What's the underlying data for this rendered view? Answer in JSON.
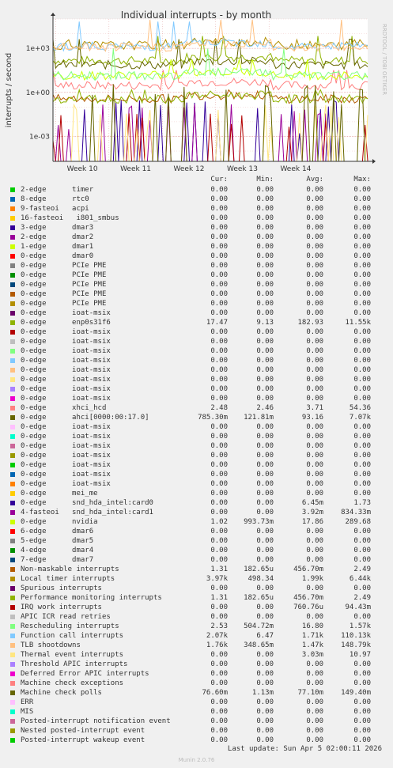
{
  "chart_data": {
    "type": "line",
    "title": "Individual interrupts - by month",
    "ylabel": "interrupts / second",
    "watermark": "RRDTOOL / TOBI OETIKER",
    "yscale": "log",
    "ylim": [
      2e-05,
      100000
    ],
    "yticks": [
      "1e+03",
      "1e+00",
      "1e-03"
    ],
    "xticks": [
      "Week 10",
      "Week 11",
      "Week 12",
      "Week 13",
      "Week 14"
    ],
    "grid": true,
    "series_note": "values read off the legend table; lines drawn as approximate levels"
  },
  "legend": {
    "headers": {
      "cur": "Cur:",
      "min": "Min:",
      "avg": "Avg:",
      "max": "Max:"
    },
    "rows": [
      {
        "color": "#00cc00",
        "label": "2-edge      timer",
        "cur": "0.00",
        "min": "0.00",
        "avg": "0.00",
        "max": "0.00"
      },
      {
        "color": "#0066b3",
        "label": "8-edge      rtc0",
        "cur": "0.00",
        "min": "0.00",
        "avg": "0.00",
        "max": "0.00"
      },
      {
        "color": "#ff8000",
        "label": "9-fasteoi   acpi",
        "cur": "0.00",
        "min": "0.00",
        "avg": "0.00",
        "max": "0.00"
      },
      {
        "color": "#ffcc00",
        "label": "16-fasteoi   i801_smbus",
        "cur": "0.00",
        "min": "0.00",
        "avg": "0.00",
        "max": "0.00"
      },
      {
        "color": "#330099",
        "label": "3-edge      dmar3",
        "cur": "0.00",
        "min": "0.00",
        "avg": "0.00",
        "max": "0.00"
      },
      {
        "color": "#990099",
        "label": "2-edge      dmar2",
        "cur": "0.00",
        "min": "0.00",
        "avg": "0.00",
        "max": "0.00"
      },
      {
        "color": "#ccff00",
        "label": "1-edge      dmar1",
        "cur": "0.00",
        "min": "0.00",
        "avg": "0.00",
        "max": "0.00"
      },
      {
        "color": "#ff0000",
        "label": "0-edge      dmar0",
        "cur": "0.00",
        "min": "0.00",
        "avg": "0.00",
        "max": "0.00"
      },
      {
        "color": "#808080",
        "label": "0-edge      PCIe PME",
        "cur": "0.00",
        "min": "0.00",
        "avg": "0.00",
        "max": "0.00"
      },
      {
        "color": "#008f00",
        "label": "0-edge      PCIe PME",
        "cur": "0.00",
        "min": "0.00",
        "avg": "0.00",
        "max": "0.00"
      },
      {
        "color": "#00487d",
        "label": "0-edge      PCIe PME",
        "cur": "0.00",
        "min": "0.00",
        "avg": "0.00",
        "max": "0.00"
      },
      {
        "color": "#b35a00",
        "label": "0-edge      PCIe PME",
        "cur": "0.00",
        "min": "0.00",
        "avg": "0.00",
        "max": "0.00"
      },
      {
        "color": "#b38f00",
        "label": "0-edge      PCIe PME",
        "cur": "0.00",
        "min": "0.00",
        "avg": "0.00",
        "max": "0.00"
      },
      {
        "color": "#6b006b",
        "label": "0-edge      ioat-msix",
        "cur": "0.00",
        "min": "0.00",
        "avg": "0.00",
        "max": "0.00"
      },
      {
        "color": "#8fb300",
        "label": "0-edge      enp0s31f6",
        "cur": "17.47",
        "min": "9.13",
        "avg": "182.93",
        "max": "11.55k"
      },
      {
        "color": "#b30000",
        "label": "0-edge      ioat-msix",
        "cur": "0.00",
        "min": "0.00",
        "avg": "0.00",
        "max": "0.00"
      },
      {
        "color": "#bebebe",
        "label": "0-edge      ioat-msix",
        "cur": "0.00",
        "min": "0.00",
        "avg": "0.00",
        "max": "0.00"
      },
      {
        "color": "#80ff80",
        "label": "0-edge      ioat-msix",
        "cur": "0.00",
        "min": "0.00",
        "avg": "0.00",
        "max": "0.00"
      },
      {
        "color": "#80c9ff",
        "label": "0-edge      ioat-msix",
        "cur": "0.00",
        "min": "0.00",
        "avg": "0.00",
        "max": "0.00"
      },
      {
        "color": "#ffc080",
        "label": "0-edge      ioat-msix",
        "cur": "0.00",
        "min": "0.00",
        "avg": "0.00",
        "max": "0.00"
      },
      {
        "color": "#ffe680",
        "label": "0-edge      ioat-msix",
        "cur": "0.00",
        "min": "0.00",
        "avg": "0.00",
        "max": "0.00"
      },
      {
        "color": "#aa80ff",
        "label": "0-edge      ioat-msix",
        "cur": "0.00",
        "min": "0.00",
        "avg": "0.00",
        "max": "0.00"
      },
      {
        "color": "#ee00cc",
        "label": "0-edge      ioat-msix",
        "cur": "0.00",
        "min": "0.00",
        "avg": "0.00",
        "max": "0.00"
      },
      {
        "color": "#ff8080",
        "label": "0-edge      xhci_hcd",
        "cur": "2.48",
        "min": "2.46",
        "avg": "3.71",
        "max": "54.36"
      },
      {
        "color": "#666600",
        "label": "0-edge      ahci[0000:00:17.0]",
        "cur": "785.30m",
        "min": "121.81m",
        "avg": "93.16",
        "max": "7.07k"
      },
      {
        "color": "#ffbfff",
        "label": "0-edge      ioat-msix",
        "cur": "0.00",
        "min": "0.00",
        "avg": "0.00",
        "max": "0.00"
      },
      {
        "color": "#00ffcc",
        "label": "0-edge      ioat-msix",
        "cur": "0.00",
        "min": "0.00",
        "avg": "0.00",
        "max": "0.00"
      },
      {
        "color": "#cc6699",
        "label": "0-edge      ioat-msix",
        "cur": "0.00",
        "min": "0.00",
        "avg": "0.00",
        "max": "0.00"
      },
      {
        "color": "#999900",
        "label": "0-edge      ioat-msix",
        "cur": "0.00",
        "min": "0.00",
        "avg": "0.00",
        "max": "0.00"
      },
      {
        "color": "#00cc00",
        "label": "0-edge      ioat-msix",
        "cur": "0.00",
        "min": "0.00",
        "avg": "0.00",
        "max": "0.00"
      },
      {
        "color": "#0066b3",
        "label": "0-edge      ioat-msix",
        "cur": "0.00",
        "min": "0.00",
        "avg": "0.00",
        "max": "0.00"
      },
      {
        "color": "#ff8000",
        "label": "0-edge      ioat-msix",
        "cur": "0.00",
        "min": "0.00",
        "avg": "0.00",
        "max": "0.00"
      },
      {
        "color": "#ffcc00",
        "label": "0-edge      mei_me",
        "cur": "0.00",
        "min": "0.00",
        "avg": "0.00",
        "max": "0.00"
      },
      {
        "color": "#330099",
        "label": "0-edge      snd_hda_intel:card0",
        "cur": "0.00",
        "min": "0.00",
        "avg": "6.45m",
        "max": "1.73"
      },
      {
        "color": "#990099",
        "label": "4-fasteoi   snd_hda_intel:card1",
        "cur": "0.00",
        "min": "0.00",
        "avg": "3.92m",
        "max": "834.33m"
      },
      {
        "color": "#ccff00",
        "label": "0-edge      nvidia",
        "cur": "1.02",
        "min": "993.73m",
        "avg": "17.86",
        "max": "289.68"
      },
      {
        "color": "#ff0000",
        "label": "6-edge      dmar6",
        "cur": "0.00",
        "min": "0.00",
        "avg": "0.00",
        "max": "0.00"
      },
      {
        "color": "#808080",
        "label": "5-edge      dmar5",
        "cur": "0.00",
        "min": "0.00",
        "avg": "0.00",
        "max": "0.00"
      },
      {
        "color": "#008f00",
        "label": "4-edge      dmar4",
        "cur": "0.00",
        "min": "0.00",
        "avg": "0.00",
        "max": "0.00"
      },
      {
        "color": "#00487d",
        "label": "7-edge      dmar7",
        "cur": "0.00",
        "min": "0.00",
        "avg": "0.00",
        "max": "0.00"
      },
      {
        "color": "#b35a00",
        "label": "Non-maskable interrupts",
        "cur": "1.31",
        "min": "182.65u",
        "avg": "456.70m",
        "max": "2.49"
      },
      {
        "color": "#b38f00",
        "label": "Local timer interrupts",
        "cur": "3.97k",
        "min": "498.34",
        "avg": "1.99k",
        "max": "6.44k"
      },
      {
        "color": "#6b006b",
        "label": "Spurious interrupts",
        "cur": "0.00",
        "min": "0.00",
        "avg": "0.00",
        "max": "0.00"
      },
      {
        "color": "#8fb300",
        "label": "Performance monitoring interrupts",
        "cur": "1.31",
        "min": "182.65u",
        "avg": "456.70m",
        "max": "2.49"
      },
      {
        "color": "#b30000",
        "label": "IRQ work interrupts",
        "cur": "0.00",
        "min": "0.00",
        "avg": "760.76u",
        "max": "94.43m"
      },
      {
        "color": "#bebebe",
        "label": "APIC ICR read retries",
        "cur": "0.00",
        "min": "0.00",
        "avg": "0.00",
        "max": "0.00"
      },
      {
        "color": "#80ff80",
        "label": "Rescheduling interrupts",
        "cur": "2.53",
        "min": "504.72m",
        "avg": "16.80",
        "max": "1.57k"
      },
      {
        "color": "#80c9ff",
        "label": "Function call interrupts",
        "cur": "2.07k",
        "min": "6.47",
        "avg": "1.71k",
        "max": "110.13k"
      },
      {
        "color": "#ffc080",
        "label": "TLB shootdowns",
        "cur": "1.76k",
        "min": "348.65m",
        "avg": "1.47k",
        "max": "148.79k"
      },
      {
        "color": "#ffe680",
        "label": "Thermal event interrupts",
        "cur": "0.00",
        "min": "0.00",
        "avg": "3.03m",
        "max": "10.97"
      },
      {
        "color": "#aa80ff",
        "label": "Threshold APIC interrupts",
        "cur": "0.00",
        "min": "0.00",
        "avg": "0.00",
        "max": "0.00"
      },
      {
        "color": "#ee00cc",
        "label": "Deferred Error APIC interrupts",
        "cur": "0.00",
        "min": "0.00",
        "avg": "0.00",
        "max": "0.00"
      },
      {
        "color": "#ff8080",
        "label": "Machine check exceptions",
        "cur": "0.00",
        "min": "0.00",
        "avg": "0.00",
        "max": "0.00"
      },
      {
        "color": "#666600",
        "label": "Machine check polls",
        "cur": "76.60m",
        "min": "1.13m",
        "avg": "77.10m",
        "max": "149.40m"
      },
      {
        "color": "#ffbfff",
        "label": "ERR",
        "cur": "0.00",
        "min": "0.00",
        "avg": "0.00",
        "max": "0.00"
      },
      {
        "color": "#00ffcc",
        "label": "MIS",
        "cur": "0.00",
        "min": "0.00",
        "avg": "0.00",
        "max": "0.00"
      },
      {
        "color": "#cc6699",
        "label": "Posted-interrupt notification event",
        "cur": "0.00",
        "min": "0.00",
        "avg": "0.00",
        "max": "0.00"
      },
      {
        "color": "#999900",
        "label": "Nested posted-interrupt event",
        "cur": "0.00",
        "min": "0.00",
        "avg": "0.00",
        "max": "0.00"
      },
      {
        "color": "#00cc00",
        "label": "Posted-interrupt wakeup event",
        "cur": "0.00",
        "min": "0.00",
        "avg": "0.00",
        "max": "0.00"
      }
    ]
  },
  "footer": {
    "last_update": "Last update: Sun Apr  5 02:00:11 2026",
    "munin_version": "Munin 2.0.76"
  }
}
